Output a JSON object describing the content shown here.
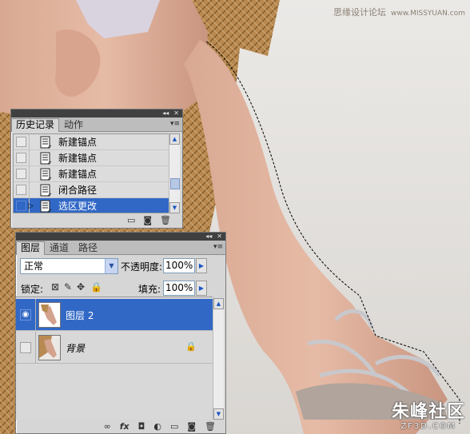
{
  "watermark_top": {
    "text": "思缘设计论坛",
    "url": "www.MISSYUAN.com"
  },
  "watermark_bottom": {
    "big": "朱峰社区",
    "small": "ZF3D.COM"
  },
  "history_panel": {
    "tabs": [
      "历史记录",
      "动作"
    ],
    "items": [
      {
        "label": "新建锚点",
        "selected": false
      },
      {
        "label": "新建锚点",
        "selected": false
      },
      {
        "label": "新建锚点",
        "selected": false
      },
      {
        "label": "闭合路径",
        "selected": false
      },
      {
        "label": "选区更改",
        "selected": true
      }
    ]
  },
  "layers_panel": {
    "tabs": [
      "图层",
      "通道",
      "路径"
    ],
    "blend_mode": "正常",
    "opacity_label": "不透明度:",
    "opacity_value": "100%",
    "lock_label": "锁定:",
    "fill_label": "填充:",
    "fill_value": "100%",
    "layers": [
      {
        "name": "图层 2",
        "selected": true,
        "visible": true
      },
      {
        "name": "背景",
        "selected": false,
        "visible": false,
        "locked": true
      }
    ]
  },
  "colors": {
    "selection": "#3168c6",
    "panel": "#d6d6d6",
    "panel_strip": "#404040"
  }
}
